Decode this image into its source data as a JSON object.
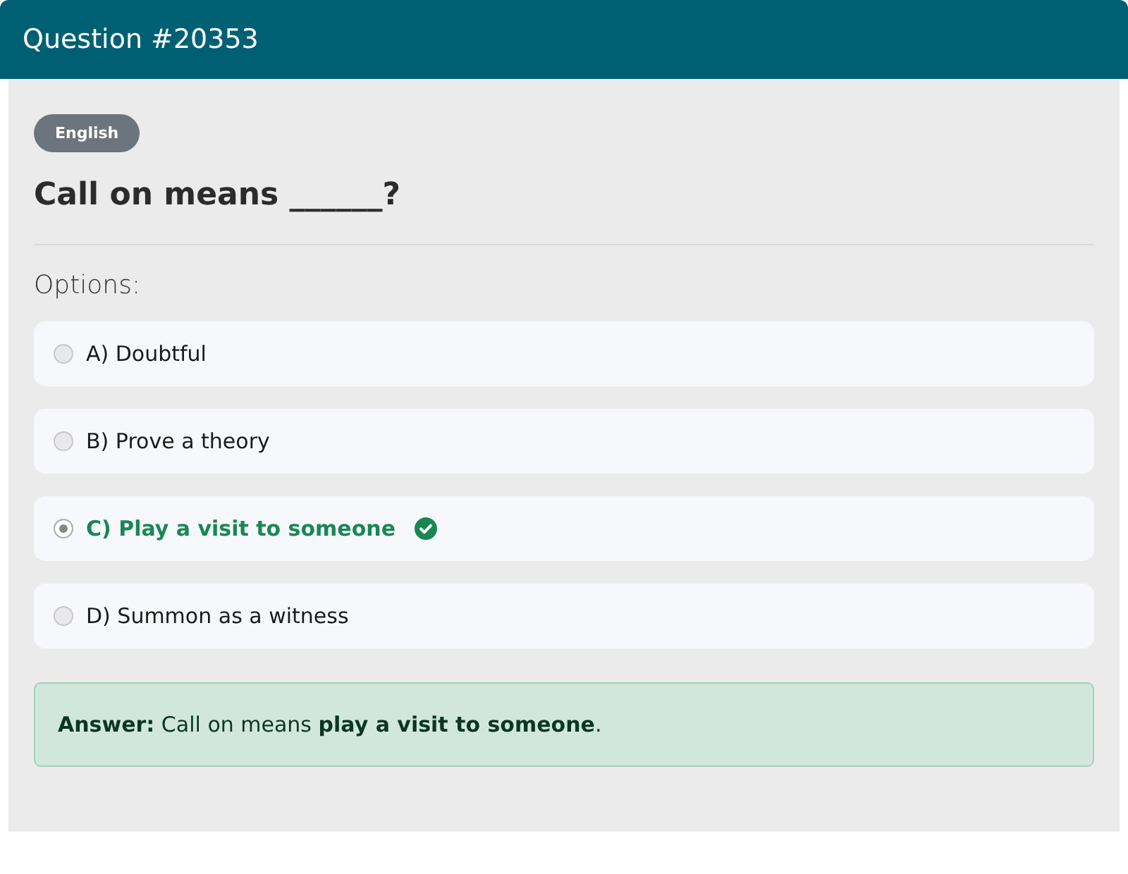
{
  "header": {
    "title": "Question #20353"
  },
  "language_badge": "English",
  "question": "Call on means ______?",
  "options_label": "Options:",
  "options": [
    {
      "label": "A) Doubtful",
      "selected": false,
      "correct": false
    },
    {
      "label": "B) Prove a theory",
      "selected": false,
      "correct": false
    },
    {
      "label": "C) Play a visit to someone",
      "selected": true,
      "correct": true
    },
    {
      "label": "D) Summon as a witness",
      "selected": false,
      "correct": false
    }
  ],
  "answer": "**Answer:** Call on means **play a visit to someone**."
}
